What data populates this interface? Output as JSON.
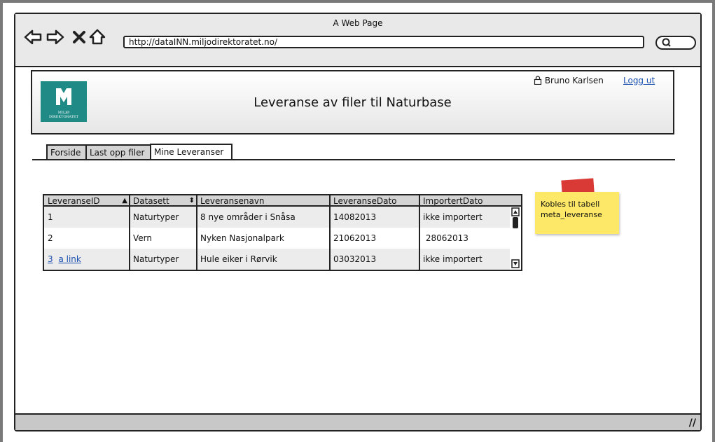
{
  "window": {
    "title": "A Web Page"
  },
  "browser": {
    "url": "http://dataINN.miljodirektoratet.no/",
    "nav": [
      "back-icon",
      "forward-icon",
      "stop-icon",
      "home-icon"
    ],
    "search_icon": "search-icon"
  },
  "header": {
    "logo_text_line1": "MILJØ",
    "logo_text_line2": "DIREKTORATET",
    "title": "Leveranse av filer til Naturbase",
    "user_name": "Bruno Karlsen",
    "logout_label": "Logg ut"
  },
  "tabs": [
    {
      "label": "Forside"
    },
    {
      "label": "Last opp filer"
    },
    {
      "label": "Mine Leveranser"
    }
  ],
  "table": {
    "columns": [
      "LeveranseID",
      "Datasett",
      "Leveransenavn",
      "LeveranseDato",
      "ImportertDato"
    ],
    "rows": [
      [
        "1",
        "Naturtyper",
        "8 nye områder i Snåsa",
        "14082013",
        "ikke importert"
      ],
      [
        "2",
        "Vern",
        "Nyken Nasjonalpark",
        "21062013",
        " 28062013"
      ],
      [
        "3",
        "Naturtyper",
        "Hule eiker i Rørvik",
        "03032013",
        "ikke importert"
      ]
    ],
    "row3_link": "a link"
  },
  "note": {
    "line1": "Kobles til tabell",
    "line2": "meta_leveranse"
  }
}
